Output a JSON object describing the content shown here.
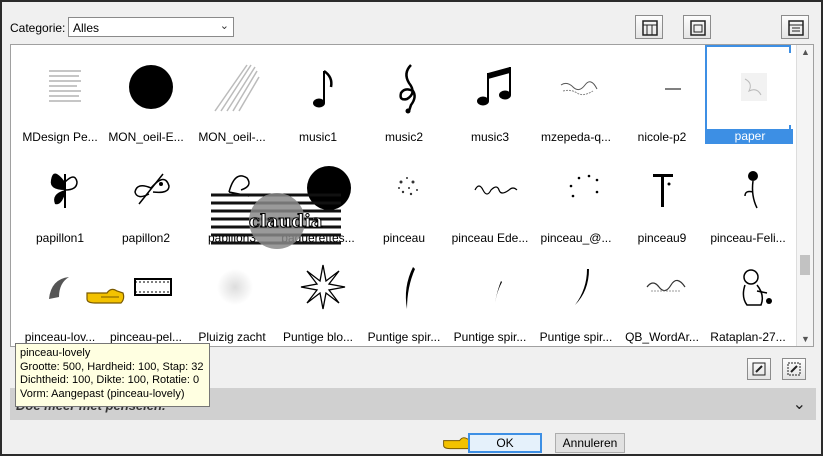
{
  "toolbar": {
    "category_label": "Categorie:",
    "category_value": "Alles"
  },
  "brushes": {
    "rows": [
      [
        {
          "label": "MDesign Pe...",
          "icon": "text-lines-thumbnail"
        },
        {
          "label": "MON_oeil-E...",
          "icon": "black-circle-thumbnail"
        },
        {
          "label": "MON_oeil-...",
          "icon": "light-rays-thumbnail"
        },
        {
          "label": "music1",
          "icon": "eighth-note-thumbnail"
        },
        {
          "label": "music2",
          "icon": "treble-clef-thumbnail"
        },
        {
          "label": "music3",
          "icon": "beamed-notes-thumbnail"
        },
        {
          "label": "mzepeda-q...",
          "icon": "scribble-thumbnail"
        },
        {
          "label": "nicole-p2",
          "icon": "dash-thumbnail"
        },
        {
          "label": "paper",
          "icon": "paper-thumbnail",
          "selected": true
        }
      ],
      [
        {
          "label": "papillon1",
          "icon": "butterfly-thumbnail"
        },
        {
          "label": "papillon2",
          "icon": "butterfly-thumbnail"
        },
        {
          "label": "papillon3",
          "icon": "butterfly-thumbnail"
        },
        {
          "label": "paquerettes...",
          "icon": "black-circle-thumbnail"
        },
        {
          "label": "pinceau",
          "icon": "sparkle-dots-thumbnail"
        },
        {
          "label": "pinceau Ede...",
          "icon": "script-text-thumbnail"
        },
        {
          "label": "pinceau_@...",
          "icon": "dotted-arc-thumbnail"
        },
        {
          "label": "pinceau9",
          "icon": "pillar-thumbnail"
        },
        {
          "label": "pinceau-Feli...",
          "icon": "flower-thumbnail"
        }
      ],
      [
        {
          "label": "pinceau-lov...",
          "icon": "swirl-thumbnail"
        },
        {
          "label": "pinceau-pel...",
          "icon": "film-strip-thumbnail"
        },
        {
          "label": "Pluizig zacht",
          "icon": "fuzzy-circle-thumbnail"
        },
        {
          "label": "Puntige blo...",
          "icon": "spiky-star-thumbnail"
        },
        {
          "label": "Puntige spir...",
          "icon": "spiral-stroke-thumbnail"
        },
        {
          "label": "Puntige spir...",
          "icon": "spiral-stroke-thumbnail"
        },
        {
          "label": "Puntige spir...",
          "icon": "spiral-stroke-thumbnail"
        },
        {
          "label": "QB_WordAr...",
          "icon": "wordart-thumbnail"
        },
        {
          "label": "Rataplan-27...",
          "icon": "cartoon-thumbnail"
        }
      ]
    ]
  },
  "watermark": {
    "text": "claudia"
  },
  "tooltip": {
    "name": "pinceau-lovely",
    "line1": "Grootte: 500, Hardheid: 100, Stap: 32",
    "line2": "Dichtheid: 100, Dikte: 100, Rotatie: 0",
    "line3": "Vorm: Aangepast (pinceau-lovely)"
  },
  "more_bar": {
    "text": "Doe meer met penselen."
  },
  "buttons": {
    "ok": "OK",
    "cancel": "Annuleren"
  }
}
